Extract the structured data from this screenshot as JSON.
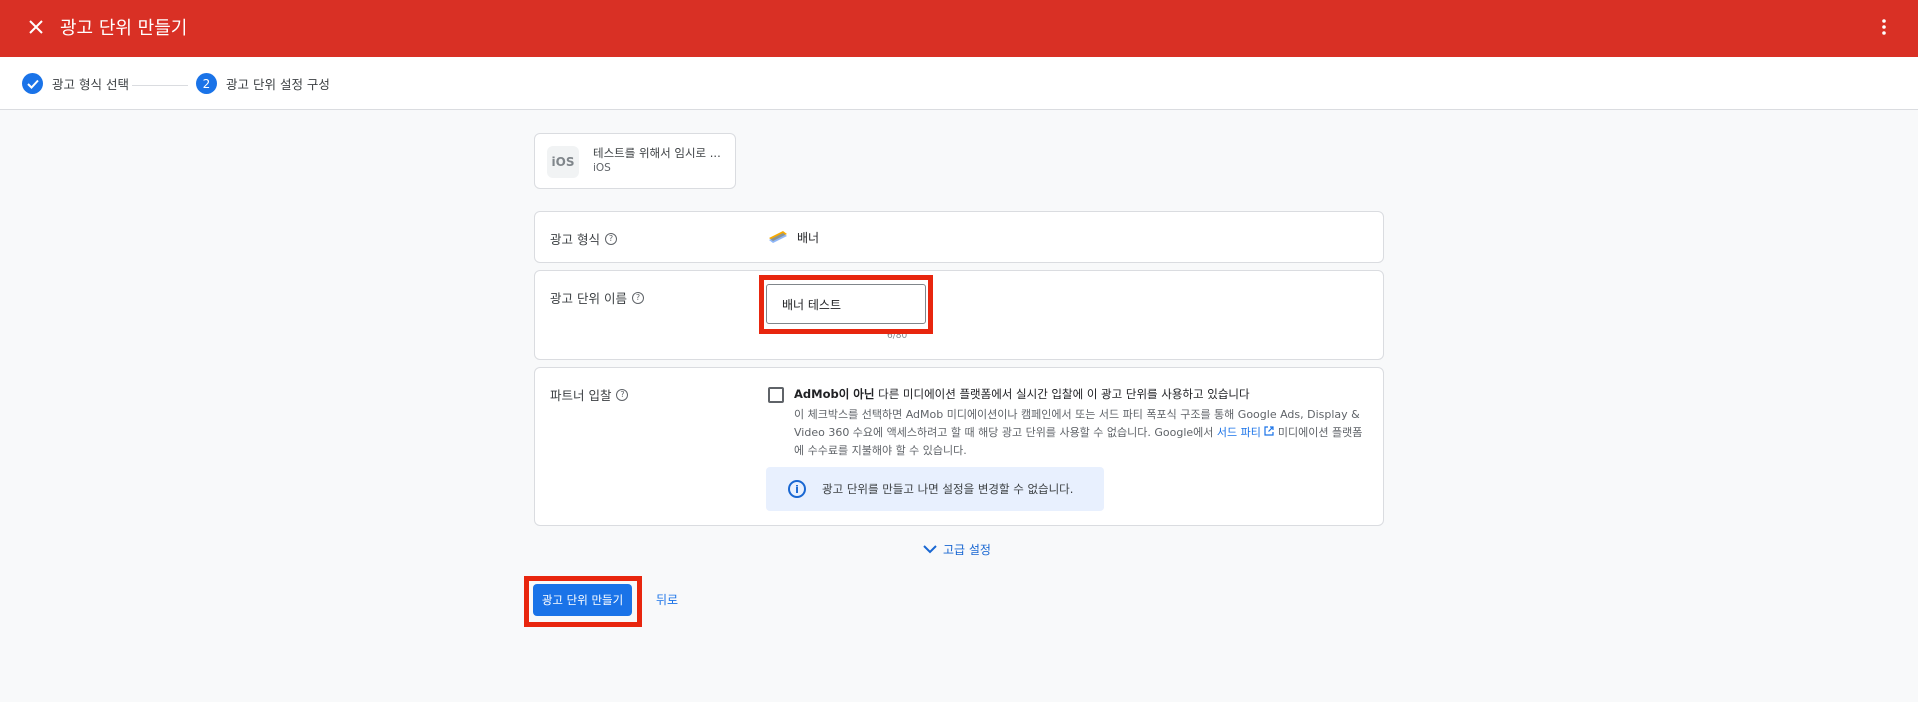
{
  "header": {
    "title": "광고 단위 만들기",
    "close_icon": "close-icon",
    "more_icon": "more-vert-icon"
  },
  "stepper": {
    "steps": [
      {
        "label": "광고 형식 선택",
        "state": "completed",
        "icon": "check-circle-icon"
      },
      {
        "number": "2",
        "label": "광고 단위 설정 구성",
        "state": "active"
      }
    ]
  },
  "app": {
    "name": "테스트를 위해서 임시로 ...",
    "platform": "iOS",
    "icon_text": "iOS"
  },
  "ad_format": {
    "label": "광고 형식",
    "value": "배너",
    "icon": "banner-format-icon"
  },
  "ad_unit_name": {
    "label": "광고 단위 이름",
    "value": "배너 테스트",
    "counter": "6/80"
  },
  "partner_bidding": {
    "label": "파트너 입찰",
    "checked": false,
    "checkbox_bold": "AdMob이 아닌",
    "checkbox_rest": " 다른 미디에이션 플랫폼에서 실시간 입찰에 이 광고 단위를 사용하고 있습니다",
    "description_before": "이 체크박스를 선택하면 AdMob 미디에이션이나 캠페인에서 또는 서드 파티 폭포식 구조를 통해 Google Ads, Display & Video 360 수요에 액세스하려고 할 때 해당 광고 단위를 사용할 수 없습니다. Google에서 ",
    "description_link": "서드 파티",
    "description_after": " 미디에이션 플랫폼에 수수료를 지불해야 할 수 있습니다.",
    "info_text": "광고 단위를 만들고 나면 설정을 변경할 수 없습니다."
  },
  "advanced_settings": "고급 설정",
  "actions": {
    "create": "광고 단위 만들기",
    "back": "뒤로"
  },
  "colors": {
    "header_bg": "#d93025",
    "primary": "#1a73e8",
    "highlight": "#e8260e",
    "info_bg": "#e8f0fe"
  }
}
